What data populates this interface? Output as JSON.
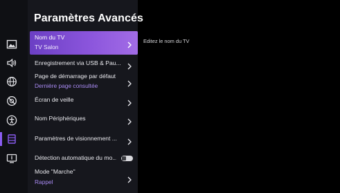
{
  "panel": {
    "title": "Paramètres Avancés"
  },
  "items": [
    {
      "label": "Nom du TV",
      "sub": "TV Salon",
      "control": "chevron",
      "selected": true
    },
    {
      "label": "Enregistrement via USB & Pau...",
      "control": "chevron"
    },
    {
      "label": "Page de démarrage par défaut",
      "sub": "Dernière page consultée",
      "control": "chevron"
    },
    {
      "label": "Écran de veille",
      "control": "chevron"
    },
    {
      "label": "Nom Périphériques",
      "control": "chevron"
    },
    {
      "label": "Paramètres de visionnement ...",
      "control": "chevron"
    },
    {
      "label": "Détection automatique du mo...",
      "control": "toggle",
      "toggle_on": false
    },
    {
      "label": "Mode \"Marche\"",
      "sub": "Rappel",
      "control": "chevron"
    }
  ],
  "sidebar_icons": [
    "picture-icon",
    "sound-icon",
    "network-icon",
    "channel-icon",
    "accessibility-icon",
    "system-icon",
    "support-icon"
  ],
  "hint": {
    "text": "Editez le nom du TV"
  },
  "colors": {
    "accent": "#8a5cf0",
    "selected_gradient_start": "#6b3fc4",
    "selected_gradient_end": "#a26ce6",
    "subtext": "#a88af2",
    "panel_bg": "#16171d",
    "iconbar_bg": "#0f1014"
  }
}
